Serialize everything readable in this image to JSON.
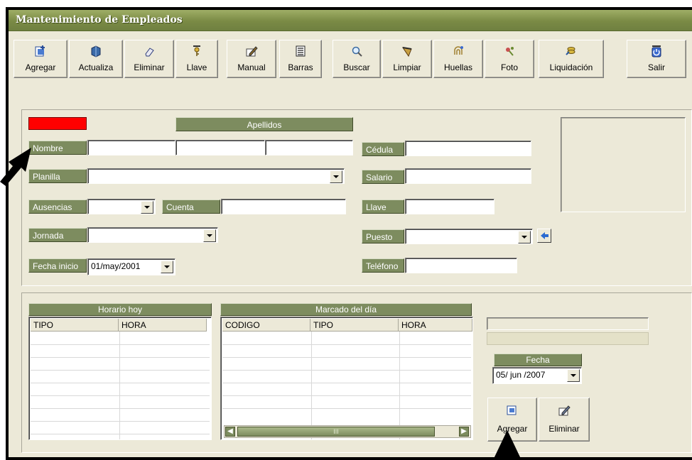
{
  "window": {
    "title": "Mantenimiento de Empleados"
  },
  "toolbar": [
    {
      "label": "Agregar",
      "icon": "add-record-icon"
    },
    {
      "label": "Actualiza",
      "icon": "update-icon"
    },
    {
      "label": "Eliminar",
      "icon": "eraser-icon"
    },
    {
      "label": "Llave",
      "icon": "key-icon"
    },
    {
      "label": "Manual",
      "icon": "edit-icon"
    },
    {
      "label": "Barras",
      "icon": "barcode-icon"
    },
    {
      "label": "Buscar",
      "icon": "search-icon"
    },
    {
      "label": "Limpiar",
      "icon": "clean-icon"
    },
    {
      "label": "Huellas",
      "icon": "fingerprint-icon"
    },
    {
      "label": "Foto",
      "icon": "photo-icon"
    },
    {
      "label": "Liquidación",
      "icon": "settlement-icon"
    },
    {
      "label": "Salir",
      "icon": "exit-icon"
    }
  ],
  "form": {
    "apellidos_label": "Apellidos",
    "nombre_label": "Nombre",
    "planilla_label": "Planilla",
    "ausencias_label": "Ausencias",
    "cuenta_label": "Cuenta",
    "jornada_label": "Jornada",
    "fecha_inicio_label": "Fecha inicio",
    "fecha_inicio_value": "01/may/2001",
    "cedula_label": "Cédula",
    "salario_label": "Salario",
    "llave_label": "Llave",
    "puesto_label": "Puesto",
    "telefono_label": "Teléfono",
    "status_color": "#FF0000"
  },
  "horario_hoy": {
    "title": "Horario hoy",
    "columns": [
      "TIPO",
      "HORA"
    ]
  },
  "marcado_dia": {
    "title": "Marcado del día",
    "columns": [
      "CODIGO",
      "TIPO",
      "HORA"
    ],
    "scroll_marker": "III"
  },
  "fecha_panel": {
    "label": "Fecha",
    "value": "05/ jun /2007"
  },
  "mark_buttons": {
    "add_label": "Agregar",
    "delete_label": "Eliminar"
  },
  "colors": {
    "label_bg": "#7D8C5F",
    "title_bg": "#7A8A45",
    "window_bg": "#ECE9D8"
  }
}
